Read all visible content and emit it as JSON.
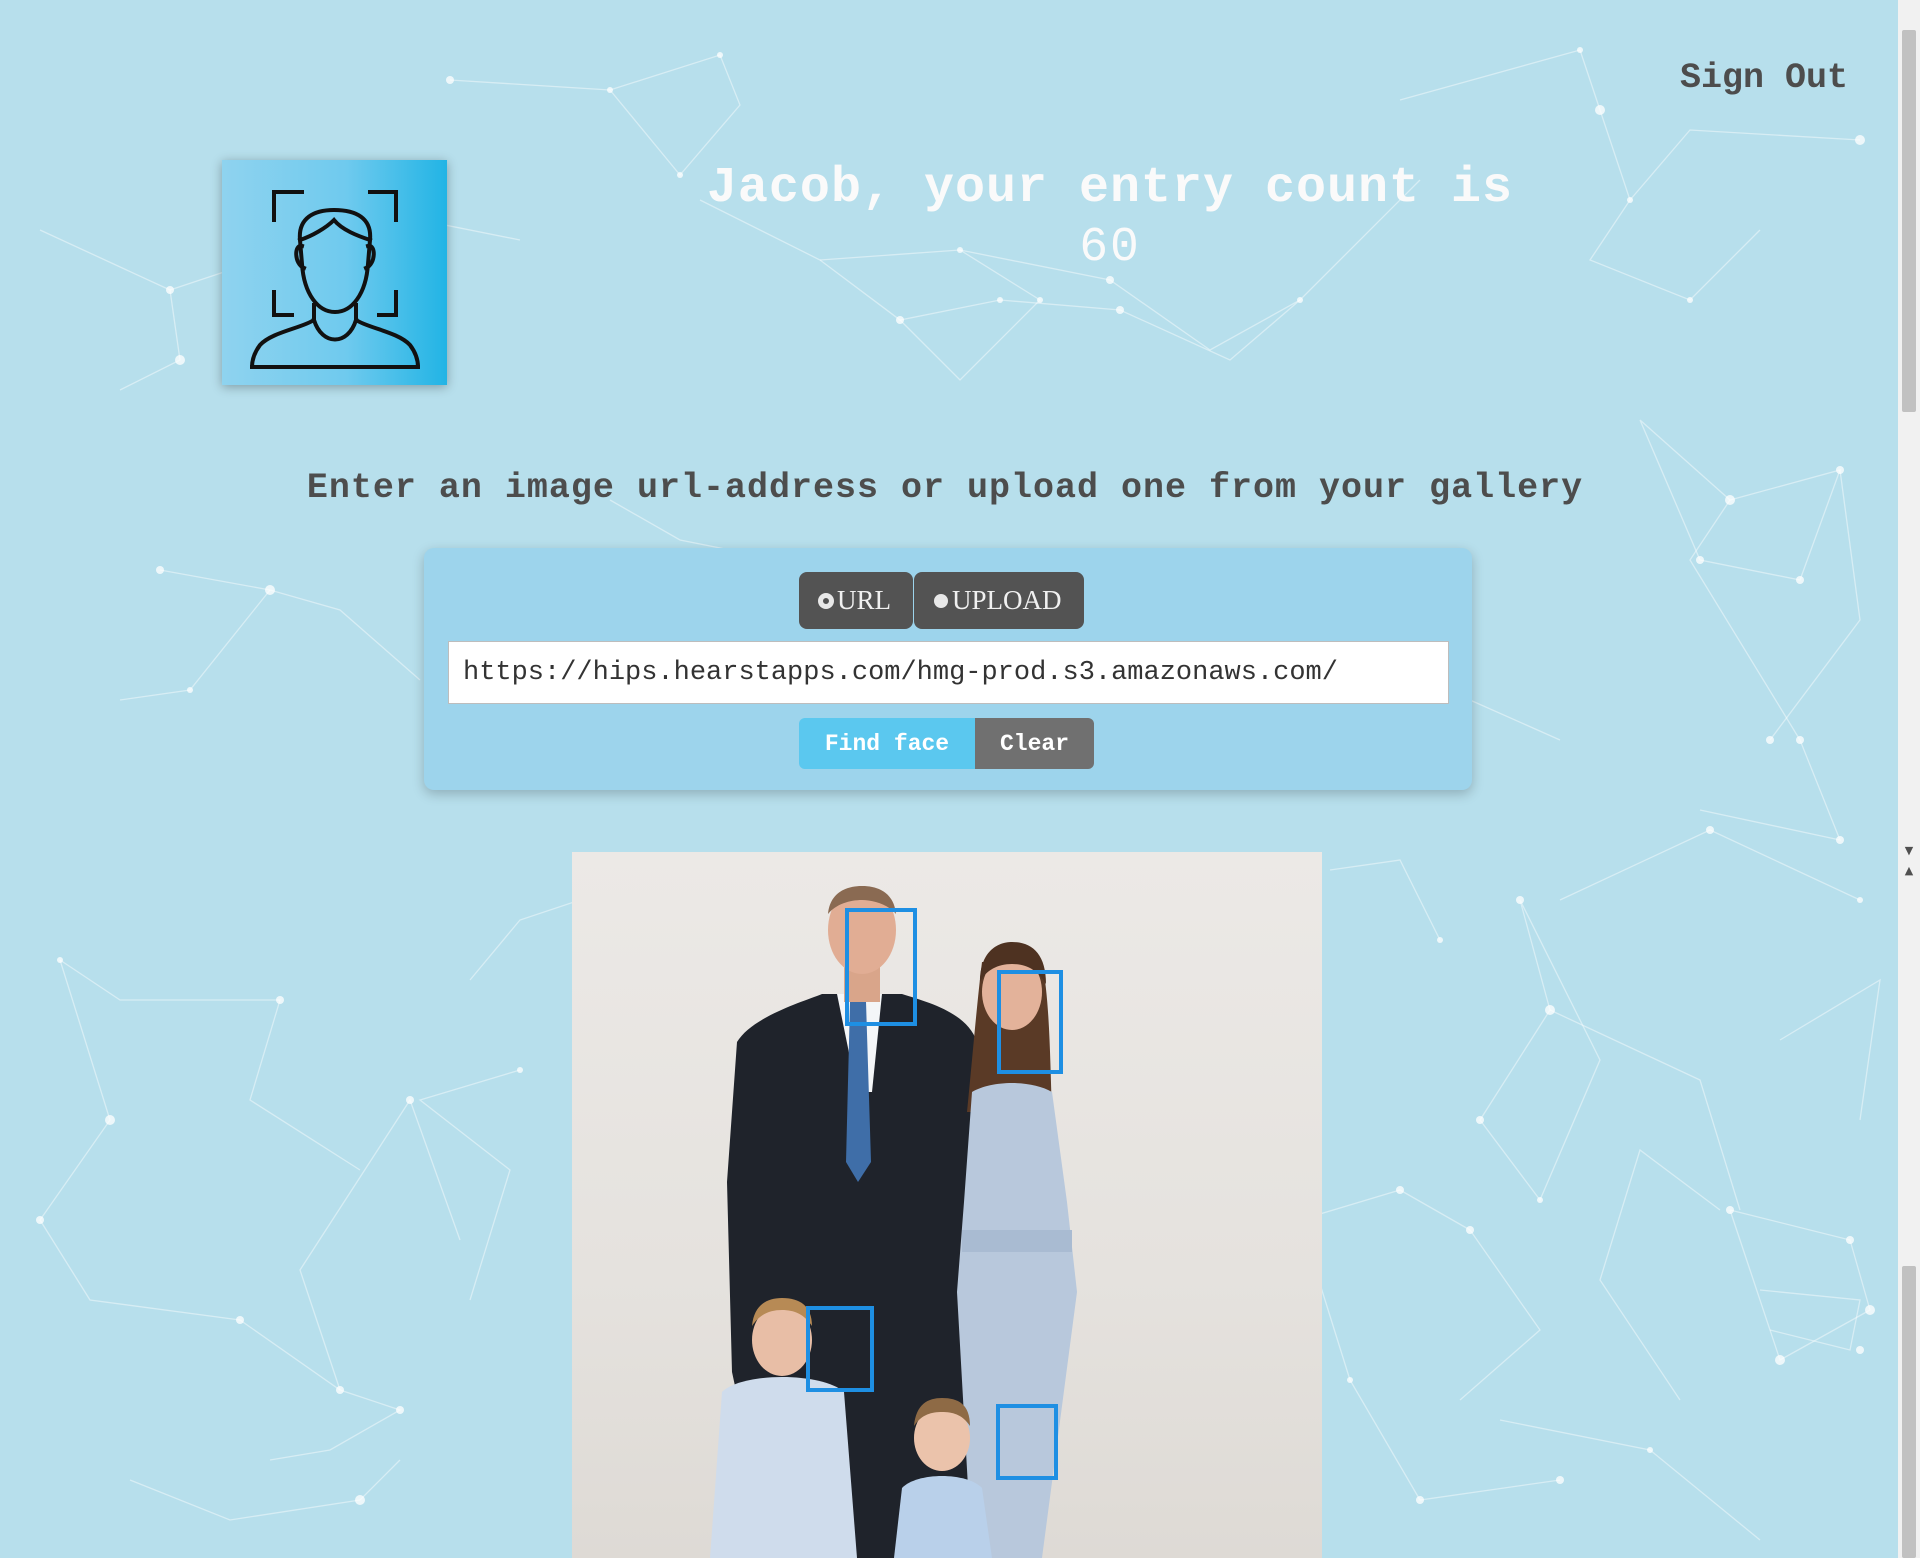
{
  "header": {
    "signout_label": "Sign Out",
    "logo_icon": "face-scan-icon"
  },
  "greeting": {
    "message": "Jacob, your entry count is",
    "entry_count": "60"
  },
  "prompt": "Enter an image url-address or upload one from your gallery",
  "input_panel": {
    "mode_options": [
      {
        "label": "URL",
        "selected": true
      },
      {
        "label": "UPLOAD",
        "selected": false
      }
    ],
    "url_value": "https://hips.hearstapps.com/hmg-prod.s3.amazonaws.com/",
    "find_face_label": "Find face",
    "clear_label": "Clear"
  },
  "result": {
    "detected_faces": 4,
    "face_box_color": "#1e8fe3"
  },
  "colors": {
    "background": "#b7dfec",
    "panel": "#9dd4ec",
    "accent": "#5bc8ef",
    "dark_button": "#535353"
  }
}
